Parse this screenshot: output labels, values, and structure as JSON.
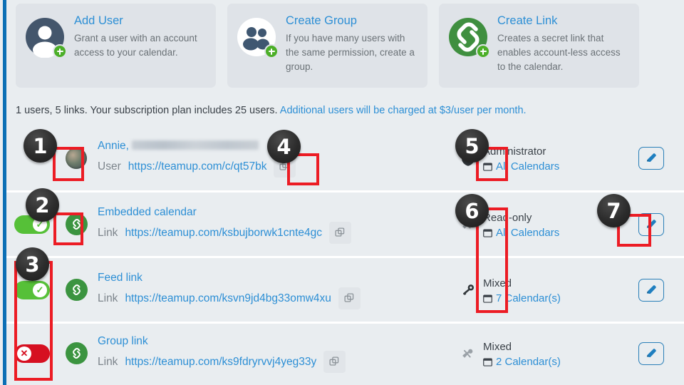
{
  "cards": [
    {
      "title": "Add User",
      "desc": "Grant a user with an account access to your calendar.",
      "icon": "user-add-icon"
    },
    {
      "title": "Create Group",
      "desc": "If you have many users with the same permission, create a group.",
      "icon": "group-add-icon"
    },
    {
      "title": "Create Link",
      "desc": "Creates a secret link that enables account-less access to the calendar.",
      "icon": "link-add-icon"
    }
  ],
  "subscription": {
    "plain": "1 users, 5 links. Your subscription plan includes 25 users.",
    "link": "Additional users will be charged at $3/user per month."
  },
  "rows": [
    {
      "toggle": null,
      "entity_icon": "avatar",
      "name": "Annie,",
      "name_redacted": true,
      "kind": "User",
      "url": "https://teamup.com/c/qt57bk",
      "copy_label": "copy-icon",
      "security_icon": "shield-2fa-icon",
      "permission": "Administrator",
      "calendars": "All Calendars",
      "calendar_icon": "calendar-icon",
      "edit_label": "pencil-icon"
    },
    {
      "toggle": "on",
      "entity_icon": "link-icon",
      "name": "Embedded calendar",
      "name_redacted": false,
      "kind": "Link",
      "url": "https://teamup.com/ksbujborwk1cnte4gc",
      "copy_label": "copy-icon",
      "security_icon": "key-disabled-icon",
      "permission": "Read-only",
      "calendars": "All Calendars",
      "calendar_icon": "calendar-icon",
      "edit_label": "pencil-icon"
    },
    {
      "toggle": "on",
      "entity_icon": "link-icon",
      "name": "Feed link",
      "name_redacted": false,
      "kind": "Link",
      "url": "https://teamup.com/ksvn9jd4bg33omw4xu",
      "copy_label": "copy-icon",
      "security_icon": "key-icon",
      "permission": "Mixed",
      "calendars": "7 Calendar(s)",
      "calendar_icon": "calendar-icon",
      "edit_label": "pencil-icon"
    },
    {
      "toggle": "off",
      "entity_icon": "link-icon",
      "name": "Group link",
      "name_redacted": false,
      "kind": "Link",
      "url": "https://teamup.com/ks9fdryrvvj4yeg33y",
      "copy_label": "copy-icon",
      "security_icon": "key-disabled-icon",
      "permission": "Mixed",
      "calendars": "2 Calendar(s)",
      "calendar_icon": "calendar-icon",
      "edit_label": "pencil-icon"
    }
  ],
  "annotations": {
    "badges": [
      "1",
      "2",
      "3",
      "4",
      "5",
      "6",
      "7"
    ]
  },
  "colors": {
    "accent_blue": "#2d8fd5",
    "rail_blue": "#0b6fb5",
    "green": "#4caf28",
    "toggle_on": "#56c038",
    "toggle_off": "#d61021",
    "highlight_red": "#ec1c24",
    "badge_dark": "#2c2c2c",
    "page_bg": "#e9edf0",
    "card_bg": "#dfe3e8"
  }
}
